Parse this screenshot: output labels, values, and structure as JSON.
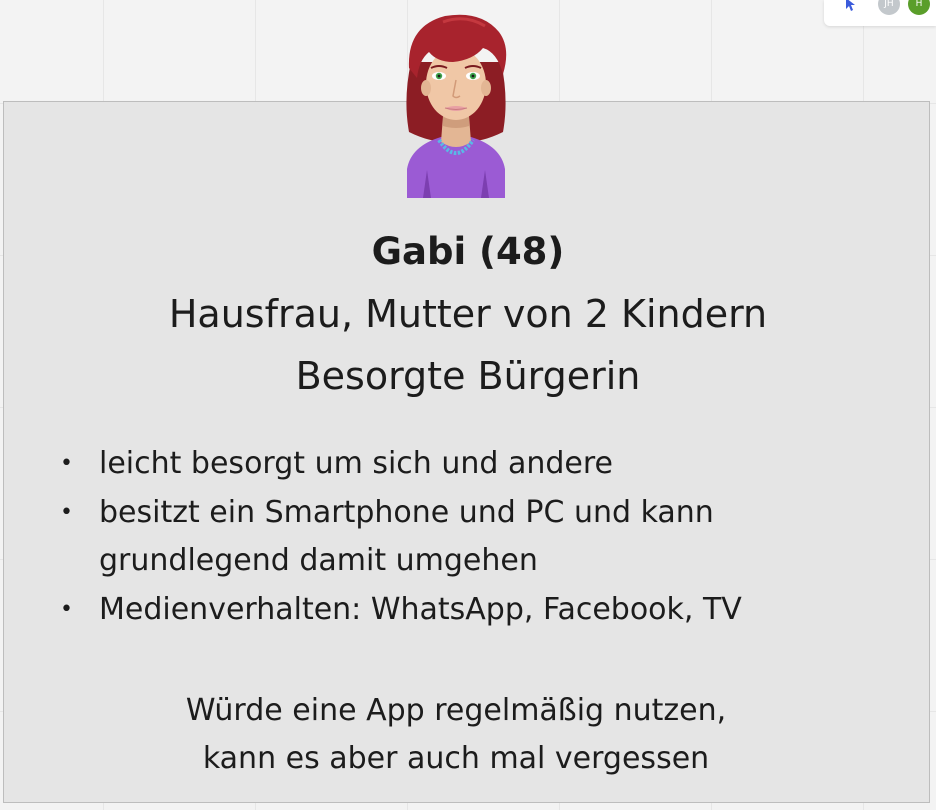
{
  "toolbar": {
    "icons": [
      "cursor-icon"
    ],
    "avatars": [
      "JH",
      "H"
    ],
    "colors": {
      "cursor": "#3b5bdb",
      "avatar_jh": "#c3c8cc",
      "avatar_h": "#5a9e2a"
    }
  },
  "persona": {
    "illustration_icon": "woman-avatar-icon",
    "name": "Gabi (48)",
    "role_line1": "Hausfrau, Mutter von 2 Kindern",
    "role_line2": "Besorgte Bürgerin",
    "traits": [
      "leicht besorgt um sich und andere",
      "besitzt ein Smartphone und PC und kann grundlegend damit umgehen",
      "Medienverhalten: WhatsApp, Facebook, TV"
    ],
    "summary_line1": "Würde eine App regelmäßig nutzen,",
    "summary_line2": "kann es aber auch mal vergessen"
  },
  "colors": {
    "card_background": "#e5e5e5",
    "canvas_background": "#f3f3f3",
    "hair": "#a8232d",
    "shirt": "#9b5bd4",
    "necklace": "#5ab8e6"
  }
}
